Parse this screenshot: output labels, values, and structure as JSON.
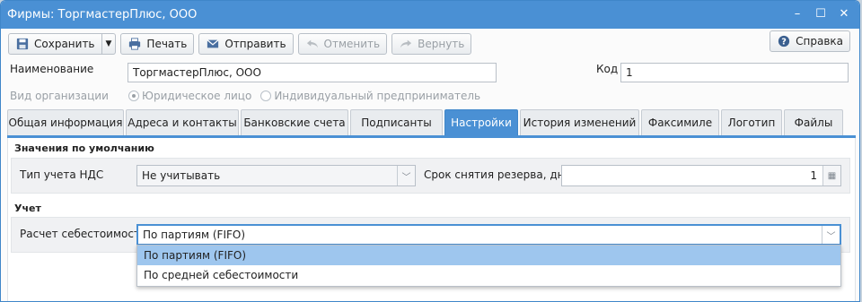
{
  "window": {
    "title": "Фирмы: ТоргмастерПлюс, ООО"
  },
  "toolbar": {
    "save": "Сохранить",
    "print": "Печать",
    "send": "Отправить",
    "cancel": "Отменить",
    "redo": "Вернуть",
    "help": "Справка"
  },
  "form": {
    "name_label": "Наименование",
    "name_value": "ТоргмастерПлюс, ООО",
    "code_label": "Код",
    "code_value": "1",
    "org_type_label": "Вид организации",
    "org_type_options": [
      "Юридическое лицо",
      "Индивидуальный предприниматель"
    ],
    "org_type_selected": "Юридическое лицо"
  },
  "tabs": [
    "Общая информация",
    "Адреса и контакты",
    "Банковские счета",
    "Подписанты",
    "Настройки",
    "История изменений",
    "Факсимиле",
    "Логотип",
    "Файлы"
  ],
  "active_tab": "Настройки",
  "defaults": {
    "section": "Значения по умолчанию",
    "vat_label": "Тип учета НДС",
    "vat_value": "Не учитывать",
    "reserve_label": "Срок снятия резерва, дней",
    "reserve_value": "1"
  },
  "accounting": {
    "section": "Учет",
    "cost_label": "Расчет себестоимости",
    "cost_value": "По партиям (FIFO)",
    "cost_options": [
      "По партиям (FIFO)",
      "По средней себестоимости"
    ]
  },
  "colors": {
    "accent": "#4a90d4",
    "selected_option": "#9ec6ee"
  }
}
